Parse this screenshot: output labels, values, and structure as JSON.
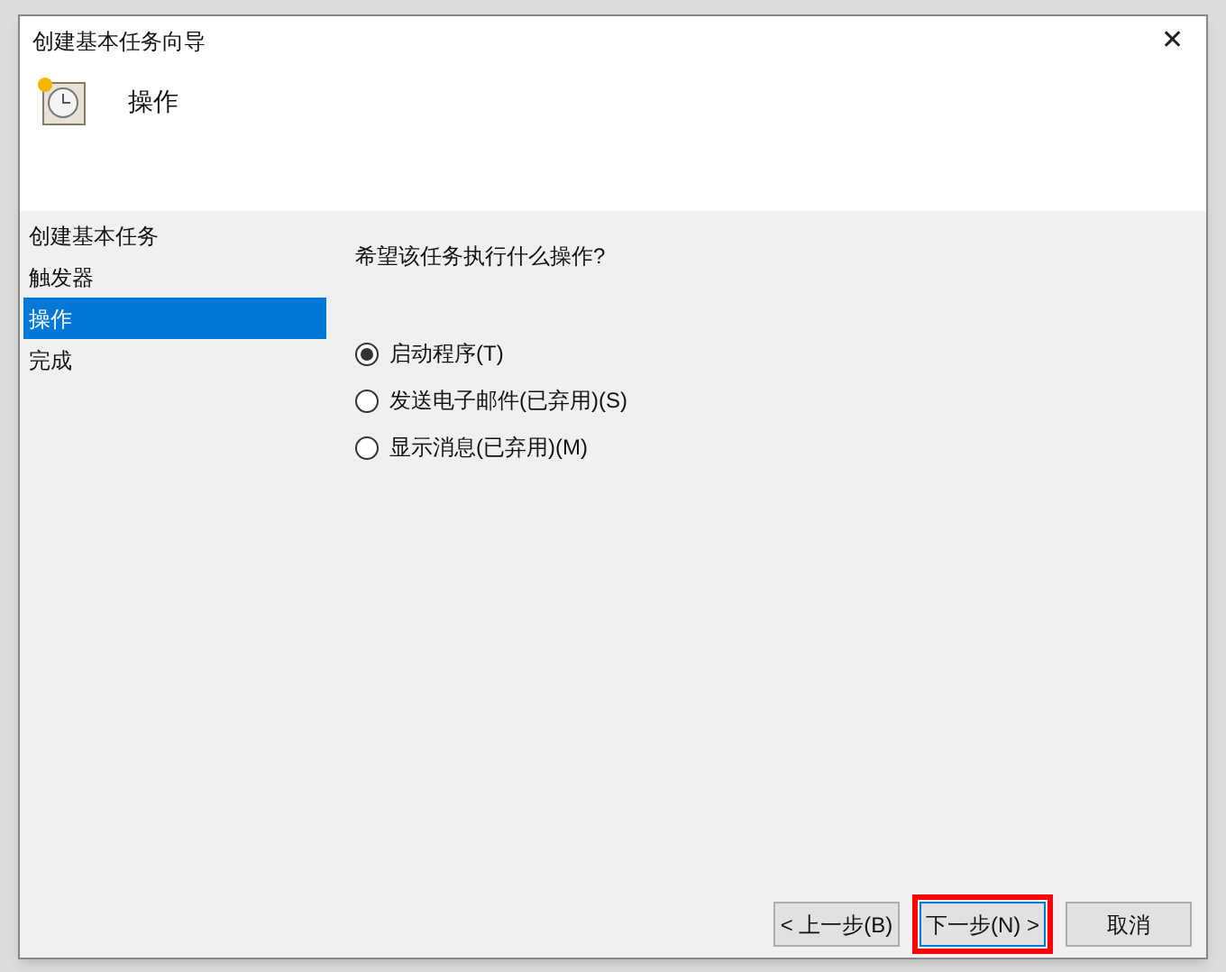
{
  "window": {
    "title": "创建基本任务向导",
    "close": "✕"
  },
  "header": {
    "title": "操作"
  },
  "steps": [
    {
      "label": "创建基本任务",
      "selected": false
    },
    {
      "label": "触发器",
      "selected": false
    },
    {
      "label": "操作",
      "selected": true
    },
    {
      "label": "完成",
      "selected": false
    }
  ],
  "question": "希望该任务执行什么操作?",
  "options": [
    {
      "label": "启动程序(T)",
      "selected": true
    },
    {
      "label": "发送电子邮件(已弃用)(S)",
      "selected": false
    },
    {
      "label": "显示消息(已弃用)(M)",
      "selected": false
    }
  ],
  "buttons": [
    {
      "label": "< 上一步(B)",
      "highlighted": false
    },
    {
      "label": "下一步(N) >",
      "highlighted": true
    },
    {
      "label": "取消",
      "highlighted": false
    }
  ]
}
